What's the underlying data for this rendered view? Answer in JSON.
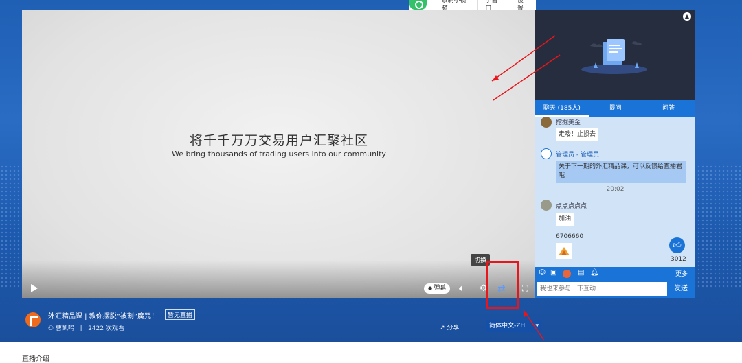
{
  "toolbar": {
    "record_label": "录制小视频",
    "mini_window_label": "小窗口",
    "settings_label": "设置"
  },
  "video": {
    "slide_title": "将千千万万交易用户汇聚社区",
    "slide_subtitle": "We bring thousands of trading users into our community",
    "danmu_label": "弹幕",
    "switch_tooltip": "切换"
  },
  "panel": {
    "tabs": [
      {
        "label": "聊天 (185人)"
      },
      {
        "label": "提问"
      },
      {
        "label": "问答"
      }
    ],
    "messages": [
      {
        "user": "挖掘美金",
        "text": "走喽！止损去"
      },
      {
        "user": "管理员 - 管理员",
        "text": "关于下一期的外汇精品课，可以反馈给直播君哦"
      },
      {
        "time": "20:02"
      },
      {
        "user": "点点点点点",
        "text": "加油"
      },
      {
        "text": "6706660"
      }
    ],
    "like_count": "3012",
    "more_label": "更多",
    "input_placeholder": "我也来参与一下互动",
    "send_label": "发送"
  },
  "info": {
    "title": "外汇精品课 | 教你摆脱“被割”魔咒！",
    "status_badge": "暂无直播",
    "host": "曹凯鸣",
    "views": "2422 次观看",
    "share_label": "分享",
    "language": "简体中文-ZH"
  },
  "bottom": {
    "section_label": "直播介绍"
  },
  "colors": {
    "accent": "#1a73d6",
    "highlight": "#e8161b"
  }
}
